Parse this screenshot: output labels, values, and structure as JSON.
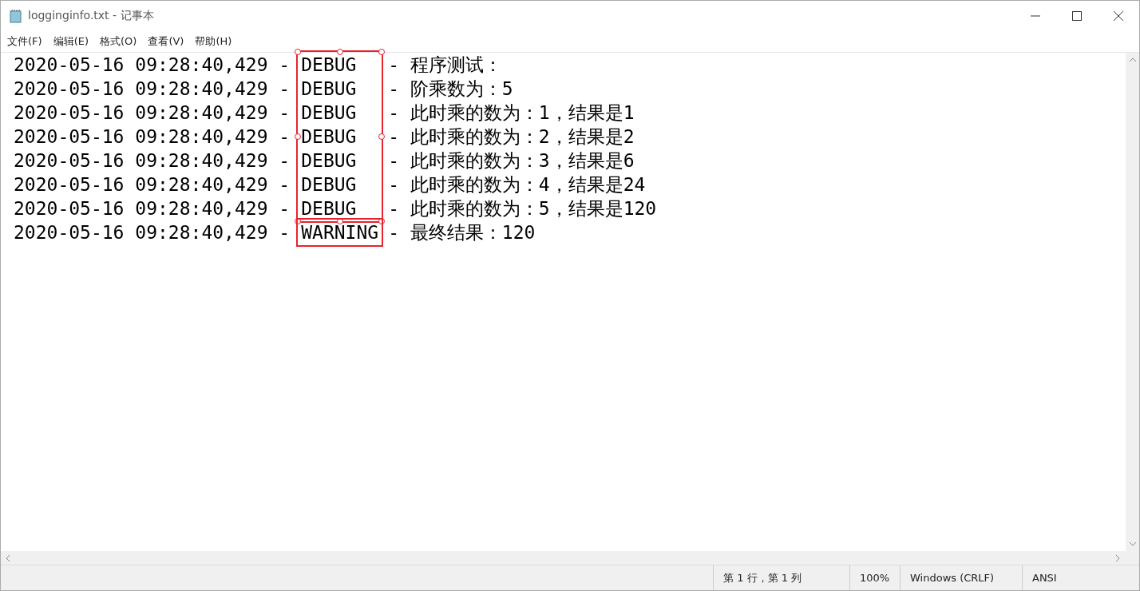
{
  "window": {
    "title": "logginginfo.txt - 记事本"
  },
  "menu": [
    "文件(F)",
    "编辑(E)",
    "格式(O)",
    "查看(V)",
    "帮助(H)"
  ],
  "blocks": [
    {
      "framed": true,
      "selected": true,
      "lines": [
        {
          "prefix": "2020-05-16 09:28:40,429 -",
          "level": "DEBUG",
          "message": "- 程序测试："
        },
        {
          "prefix": "2020-05-16 09:28:40,429 -",
          "level": "DEBUG",
          "message": "- 阶乘数为：5"
        },
        {
          "prefix": "2020-05-16 09:28:40,429 -",
          "level": "DEBUG",
          "message": "- 此时乘的数为：1，结果是1"
        },
        {
          "prefix": "2020-05-16 09:28:40,429 -",
          "level": "DEBUG",
          "message": "- 此时乘的数为：2，结果是2"
        },
        {
          "prefix": "2020-05-16 09:28:40,429 -",
          "level": "DEBUG",
          "message": "- 此时乘的数为：3，结果是6"
        },
        {
          "prefix": "2020-05-16 09:28:40,429 -",
          "level": "DEBUG",
          "message": "- 此时乘的数为：4，结果是24"
        },
        {
          "prefix": "2020-05-16 09:28:40,429 -",
          "level": "DEBUG",
          "message": "- 此时乘的数为：5，结果是120"
        }
      ]
    },
    {
      "framed": true,
      "selected": false,
      "lines": [
        {
          "prefix": "2020-05-16 09:28:40,429 -",
          "level": "WARNING",
          "message": "- 最终结果：120"
        }
      ]
    }
  ],
  "status_bar": [
    "第 1 行，第 1 列",
    "100%",
    "Windows (CRLF)",
    "ANSI"
  ]
}
